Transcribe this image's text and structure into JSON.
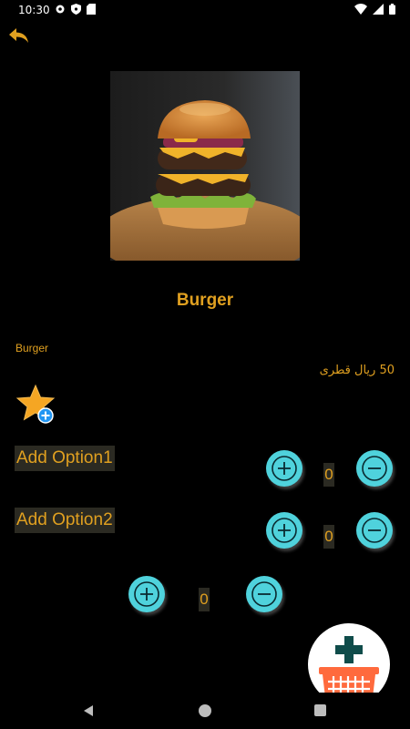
{
  "status_bar": {
    "time": "10:30",
    "left_icons": [
      "settings-icon",
      "shield-icon",
      "sim-card-icon"
    ],
    "right_icons": [
      "wifi-icon",
      "signal-icon",
      "battery-icon"
    ]
  },
  "header": {
    "back_icon": "reply-arrow-icon"
  },
  "product": {
    "image_alt": "burger-photo",
    "title": "Burger",
    "description": "Burger",
    "price": "50 ريال قطرى"
  },
  "favorite": {
    "icon": "star-add-icon"
  },
  "options": [
    {
      "label": "Add Option1",
      "quantity": "0"
    },
    {
      "label": "Add Option2",
      "quantity": "0"
    }
  ],
  "main_quantity": "0",
  "cart": {
    "icon": "add-to-cart-basket-icon"
  },
  "nav_bar": {
    "back": "nav-back-icon",
    "home": "nav-home-icon",
    "recents": "nav-recents-icon"
  },
  "colors": {
    "accent": "#e0a020",
    "button": "#4fd2dc",
    "background": "#000000",
    "cart_basket": "#ff6a3d",
    "cart_plus": "#0f4c4a"
  }
}
